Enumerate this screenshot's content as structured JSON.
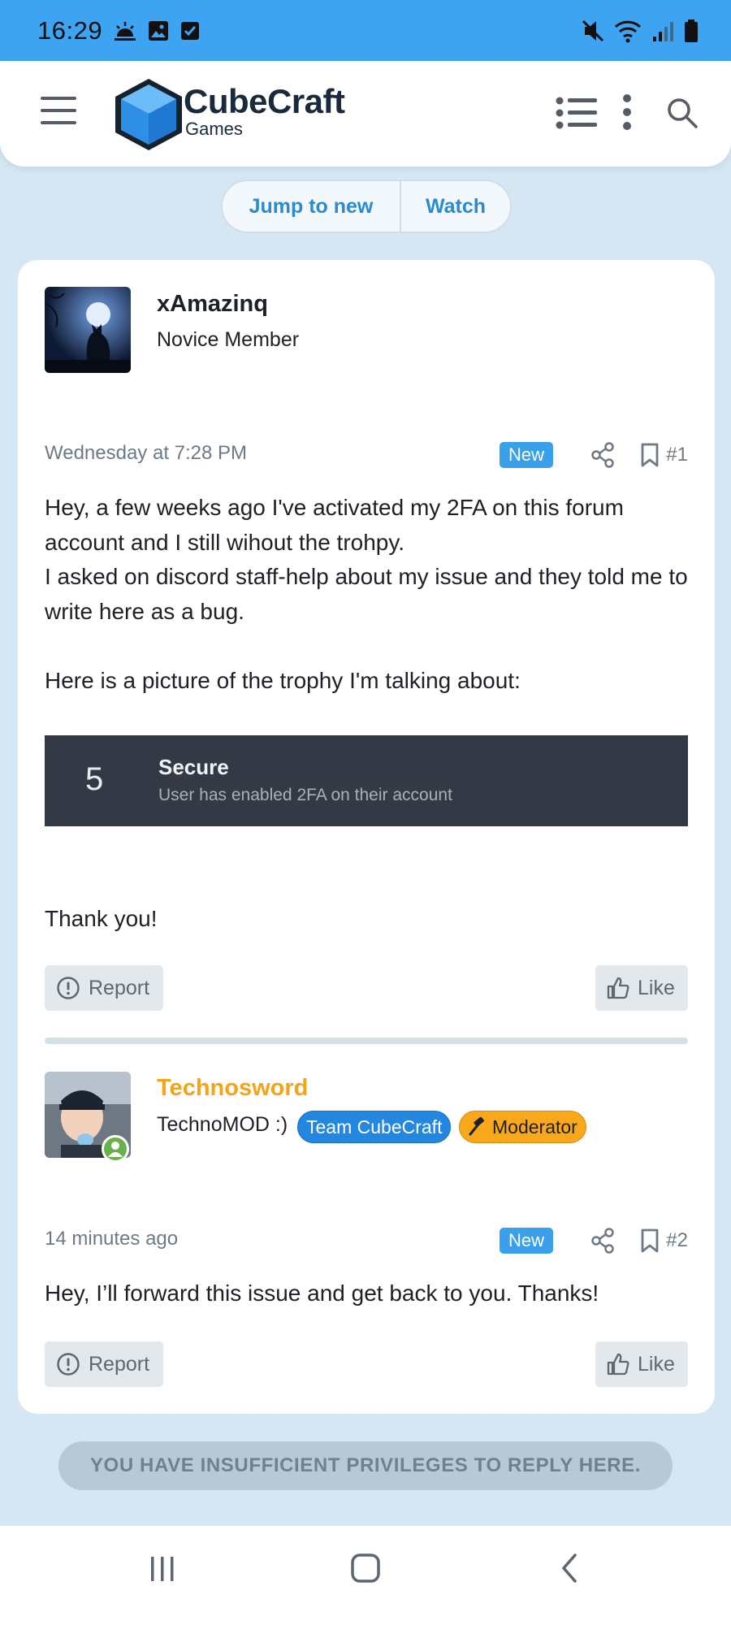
{
  "status_bar": {
    "time": "16:29",
    "left_icons": [
      "weather-icon",
      "gallery-icon",
      "checkbox-icon"
    ],
    "right_icons": [
      "mute-icon",
      "wifi-icon",
      "signal-icon",
      "battery-icon"
    ]
  },
  "header": {
    "brand_name": "CubeCraft",
    "brand_sub": "Games",
    "icons": [
      "menu-icon",
      "cube-logo-icon",
      "list-icon",
      "more-vertical-icon",
      "search-icon"
    ]
  },
  "thread_actions": {
    "jump_label": "Jump to new",
    "watch_label": "Watch"
  },
  "posts": [
    {
      "username": "xAmazinq",
      "user_title": "Novice Member",
      "date": "Wednesday at 7:28 PM",
      "badge": "New",
      "number": "#1",
      "body": [
        "Hey, a few weeks ago I've activated my 2FA on this forum account and I still wihout the trohpy.",
        "I asked on discord staff-help about my issue and they told me to write here as a bug.",
        "Here is a picture of the trophy I'm talking about:",
        "Thank you!"
      ],
      "trophy": {
        "points": "5",
        "name": "Secure",
        "description": "User has enabled 2FA on their account"
      },
      "report_label": "Report",
      "like_label": "Like"
    },
    {
      "username": "Technosword",
      "user_title": "TechnoMOD :)",
      "tags": [
        "Team CubeCraft",
        "Moderator"
      ],
      "date": "14 minutes ago",
      "badge": "New",
      "number": "#2",
      "body": [
        "Hey, I’ll forward this issue and get back to you. Thanks!"
      ],
      "report_label": "Report",
      "like_label": "Like"
    }
  ],
  "no_reply_notice": "YOU HAVE INSUFFICIENT PRIVILEGES TO REPLY HERE.",
  "colors": {
    "status_bar": "#3ea3f0",
    "page_bg": "#d6e7f4",
    "link_blue": "#2b8ad0",
    "moderator_name": "#f4a417",
    "team_tag": "#2387e0",
    "moderator_tag": "#f9a71b"
  },
  "nav_bar": {
    "icons": [
      "recent-apps-icon",
      "home-icon",
      "back-icon"
    ]
  }
}
